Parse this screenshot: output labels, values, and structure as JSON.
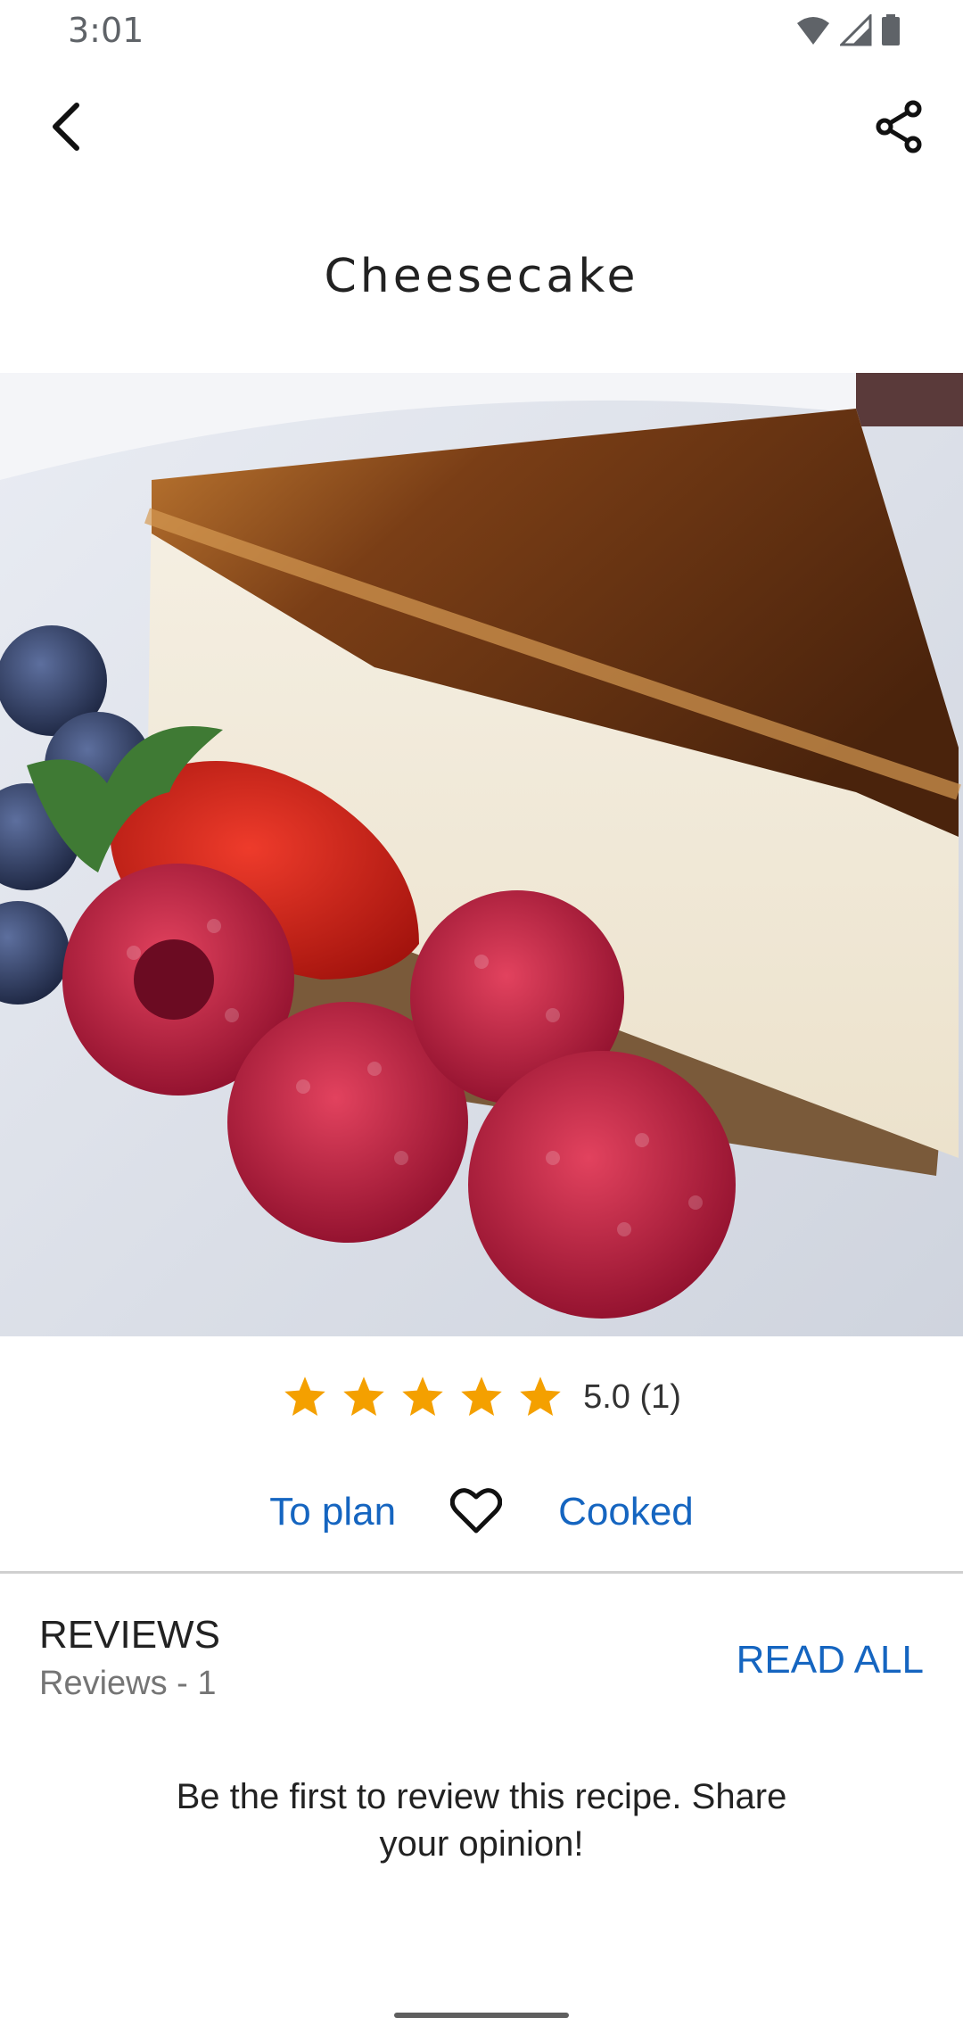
{
  "status_bar": {
    "time": "3:01",
    "icons": [
      "wifi-icon",
      "cellular-icon",
      "battery-icon"
    ]
  },
  "toolbar": {
    "back_icon": "chevron-left-icon",
    "share_icon": "share-icon"
  },
  "recipe": {
    "title": "Cheesecake",
    "image_description_icon": "cheesecake-photo"
  },
  "rating": {
    "stars_filled": 5,
    "stars_total": 5,
    "text": "5.0 (1)",
    "star_color": "#f4a000"
  },
  "actions": {
    "to_plan": "To plan",
    "favorite_icon": "heart-outline-icon",
    "cooked": "Cooked",
    "link_color": "#1565c0"
  },
  "reviews": {
    "heading": "REVIEWS",
    "count_label": "Reviews - 1",
    "read_all": "READ ALL",
    "empty_message": "Be the first to review this recipe. Share your opinion!"
  }
}
